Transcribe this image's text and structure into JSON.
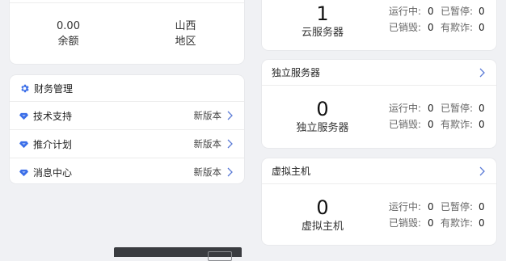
{
  "summary": {
    "balance": {
      "value": "0.00",
      "label": "余额"
    },
    "region": {
      "value": "山西",
      "label": "地区"
    }
  },
  "finance": {
    "title": "财务管理",
    "items": [
      {
        "label": "技术支持",
        "tag": "新版本"
      },
      {
        "label": "推介计划",
        "tag": "新版本"
      },
      {
        "label": "消息中心",
        "tag": "新版本"
      }
    ]
  },
  "cloud": {
    "count": "1",
    "label": "云服务器",
    "stats": {
      "running_label": "运行中:",
      "running": "0",
      "paused_label": "已暂停:",
      "paused": "0",
      "destroyed_label": "已销毁:",
      "destroyed": "0",
      "fraud_label": "有欺诈:",
      "fraud": "0"
    }
  },
  "dedicated": {
    "title": "独立服务器",
    "count": "0",
    "label": "独立服务器",
    "stats": {
      "running_label": "运行中:",
      "running": "0",
      "paused_label": "已暂停:",
      "paused": "0",
      "destroyed_label": "已销毁:",
      "destroyed": "0",
      "fraud_label": "有欺诈:",
      "fraud": "0"
    }
  },
  "vhost": {
    "title": "虚拟主机",
    "count": "0",
    "label": "虚拟主机",
    "stats": {
      "running_label": "运行中:",
      "running": "0",
      "paused_label": "已暂停:",
      "paused": "0",
      "destroyed_label": "已销毁:",
      "destroyed": "0",
      "fraud_label": "有欺诈:",
      "fraud": "0"
    }
  },
  "colors": {
    "accent": "#3b6ee8",
    "background": "#f0f1f4",
    "card": "#ffffff"
  },
  "icons": {
    "finance": "gear-icon",
    "row": "diamond-icon",
    "nav": "chevron-right-icon"
  }
}
